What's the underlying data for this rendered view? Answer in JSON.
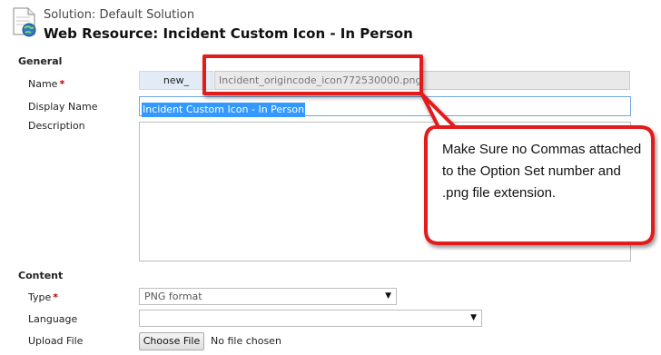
{
  "header": {
    "solution": "Solution: Default Solution",
    "title": "Web Resource: Incident Custom Icon - In Person"
  },
  "general": {
    "section_title": "General",
    "name_label": "Name",
    "required_marker": "*",
    "name_prefix": "new_",
    "name_value": "Incident_origincode_icon772530000.png",
    "display_name_label": "Display Name",
    "display_name_value": "Incident Custom Icon - In Person",
    "description_label": "Description",
    "description_value": ""
  },
  "content": {
    "section_title": "Content",
    "type_label": "Type",
    "type_value": "PNG format",
    "language_label": "Language",
    "language_value": "",
    "upload_label": "Upload File",
    "choose_file_label": "Choose File",
    "no_file_text": "No file chosen"
  },
  "annotation": {
    "callout_text": "Make Sure no Commas attached to the Option Set number and .png file extension.",
    "color": "#e21b1b"
  },
  "icons": {
    "page": "web-resource-document-icon",
    "dropdown": "chevron-down-icon"
  }
}
